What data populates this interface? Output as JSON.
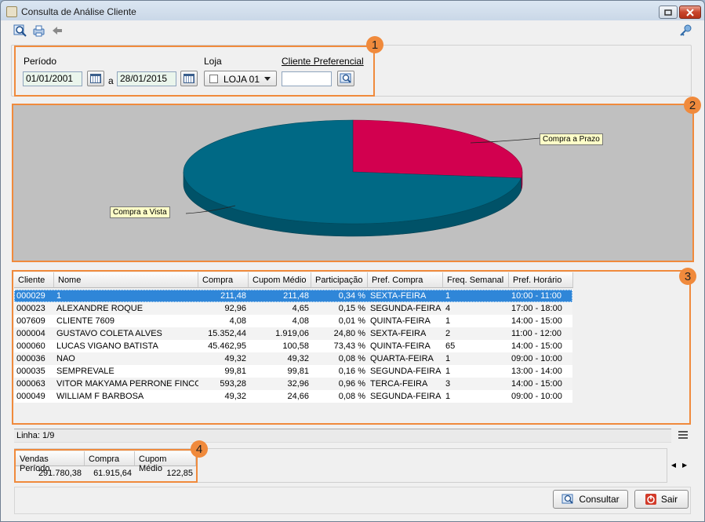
{
  "window": {
    "title": "Consulta de Análise Cliente"
  },
  "badges": [
    "1",
    "2",
    "3",
    "4"
  ],
  "filters": {
    "period_label": "Período",
    "date_from": "01/01/2001",
    "separator": "a",
    "date_to": "28/01/2015",
    "store_label": "Loja",
    "store_value": "LOJA 01",
    "preferred_client_label": "Cliente Preferencial",
    "preferred_client_value": ""
  },
  "chart_data": {
    "type": "pie",
    "slices": [
      {
        "label": "Compra a Prazo",
        "value": 26.9,
        "color": "#d2004f"
      },
      {
        "label": "Compra a Vista",
        "value": 73.1,
        "color": "#006985"
      }
    ]
  },
  "table": {
    "columns": [
      "Cliente",
      "Nome",
      "Compra",
      "Cupom Médio",
      "Participação",
      "Pref. Compra",
      "Freq. Semanal",
      "Pref. Horário"
    ],
    "rows": [
      [
        "000029",
        "1",
        "211,48",
        "211,48",
        "0,34 %",
        "SEXTA-FEIRA",
        "1",
        "10:00 - 11:00"
      ],
      [
        "000023",
        "ALEXANDRE ROQUE",
        "92,96",
        "4,65",
        "0,15 %",
        "SEGUNDA-FEIRA",
        "4",
        "17:00 - 18:00"
      ],
      [
        "007609",
        "CLIENTE 7609",
        "4,08",
        "4,08",
        "0,01 %",
        "QUINTA-FEIRA",
        "1",
        "14:00 - 15:00"
      ],
      [
        "000004",
        "GUSTAVO COLETA ALVES",
        "15.352,44",
        "1.919,06",
        "24,80 %",
        "SEXTA-FEIRA",
        "2",
        "11:00 - 12:00"
      ],
      [
        "000060",
        "LUCAS VIGANO BATISTA",
        "45.462,95",
        "100,58",
        "73,43 %",
        "QUINTA-FEIRA",
        "65",
        "14:00 - 15:00"
      ],
      [
        "000036",
        "NAO",
        "49,32",
        "49,32",
        "0,08 %",
        "QUARTA-FEIRA",
        "1",
        "09:00 - 10:00"
      ],
      [
        "000035",
        "SEMPREVALE",
        "99,81",
        "99,81",
        "0,16 %",
        "SEGUNDA-FEIRA",
        "1",
        "13:00 - 14:00"
      ],
      [
        "000063",
        "VITOR MAKYAMA PERRONE FINCO",
        "593,28",
        "32,96",
        "0,96 %",
        "TERCA-FEIRA",
        "3",
        "14:00 - 15:00"
      ],
      [
        "000049",
        "WILLIAM F BARBOSA",
        "49,32",
        "24,66",
        "0,08 %",
        "SEGUNDA-FEIRA",
        "1",
        "09:00 - 10:00"
      ]
    ],
    "status": "Linha: 1/9"
  },
  "totals": {
    "headers": [
      "Vendas Período",
      "Compra",
      "Cupom Médio"
    ],
    "values": [
      "291.780,38",
      "61.915,64",
      "122,85"
    ]
  },
  "buttons": {
    "consult": "Consultar",
    "exit": "Sair"
  },
  "colors": {
    "accent": "#f08a3c",
    "selection": "#2f86d8"
  }
}
